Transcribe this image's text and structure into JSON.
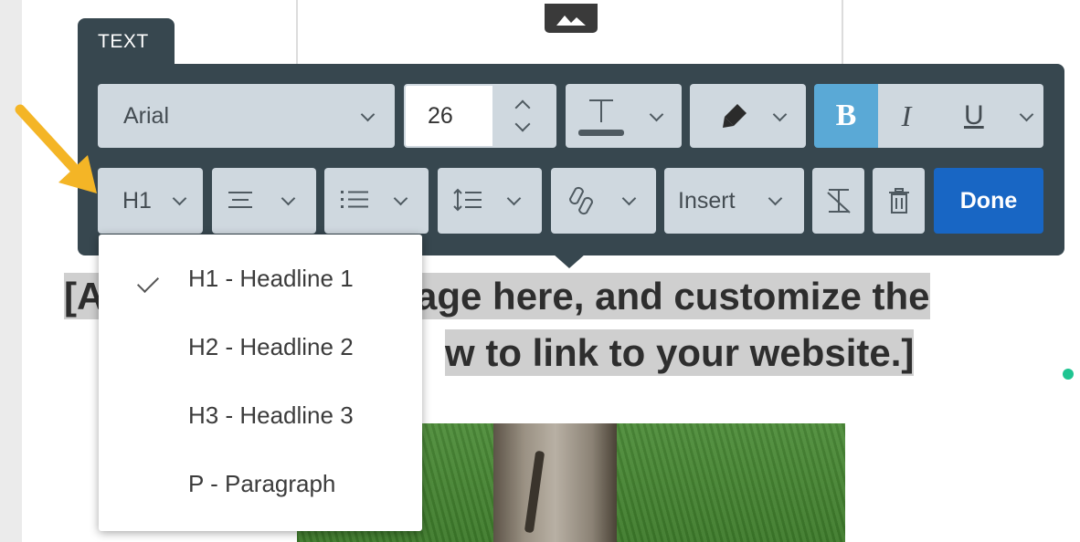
{
  "toolbar": {
    "tab_label": "TEXT",
    "font_family": "Arial",
    "font_size": "26",
    "bold_label": "B",
    "italic_label": "I",
    "underline_label": "U",
    "heading_value": "H1",
    "insert_label": "Insert",
    "done_label": "Done"
  },
  "heading_menu": {
    "items": [
      {
        "label": "H1 - Headline 1",
        "selected": true
      },
      {
        "label": "H2 - Headline 2",
        "selected": false
      },
      {
        "label": "H3 - Headline 3",
        "selected": false
      },
      {
        "label": "P - Paragraph",
        "selected": false
      }
    ]
  },
  "canvas": {
    "headline_line1_start": "[A",
    "headline_line1_end": "age here, and customize the",
    "headline_line2_end": "w to link to your website.]"
  },
  "colors": {
    "toolbar_bg": "#37474f",
    "button_bg": "#cfd8df",
    "bold_active": "#5aa9d6",
    "done_bg": "#1866c4",
    "annotation_arrow": "#f4b526",
    "status_dot": "#1fc491"
  },
  "icons": [
    "image-icon",
    "text-color-icon",
    "highlighter-icon",
    "align-icon",
    "list-icon",
    "line-spacing-icon",
    "link-icon",
    "clear-format-icon",
    "trash-icon",
    "checkmark-icon",
    "arrow-annotation"
  ]
}
